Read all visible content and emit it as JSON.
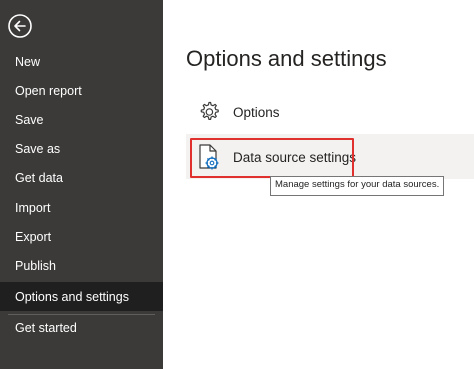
{
  "sidebar": {
    "back_icon": "back-arrow-icon",
    "items": [
      {
        "label": "New"
      },
      {
        "label": "Open report"
      },
      {
        "label": "Save"
      },
      {
        "label": "Save as"
      },
      {
        "label": "Get data"
      },
      {
        "label": "Import"
      },
      {
        "label": "Export"
      },
      {
        "label": "Publish"
      },
      {
        "label": "Options and settings",
        "selected": true
      },
      {
        "label": "Get started"
      }
    ]
  },
  "main": {
    "title": "Options and settings",
    "options": [
      {
        "label": "Options",
        "icon": "gear-icon"
      },
      {
        "label": "Data source settings",
        "icon": "document-gear-icon",
        "highlighted": true
      }
    ],
    "tooltip": "Manage settings for your data sources."
  },
  "colors": {
    "sidebar_bg": "#3b3a39",
    "selected_item_bg": "#1f1f1f",
    "highlight_border": "#e0312f",
    "icon_accent": "#0f6cbd"
  }
}
